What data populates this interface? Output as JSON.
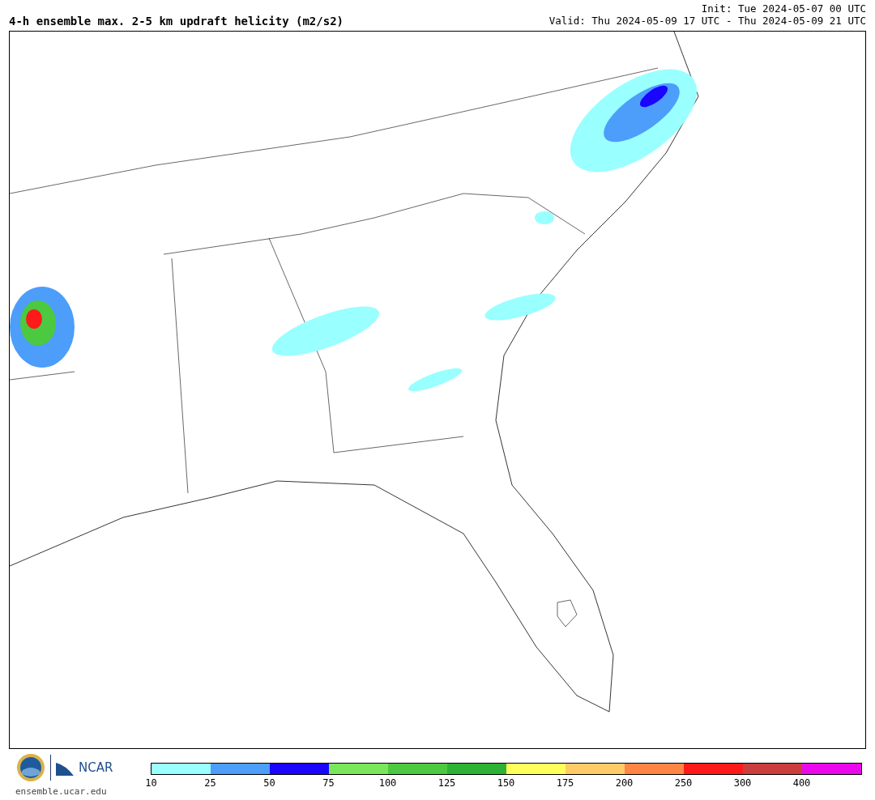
{
  "title": "4-h ensemble max. 2-5 km updraft helicity (m2/s2)",
  "init": "Init: Tue 2024-05-07 00 UTC",
  "valid": "Valid: Thu 2024-05-09 17 UTC - Thu 2024-05-09 21 UTC",
  "logo_text": "NCAR",
  "website": "ensemble.ucar.edu",
  "colorbar": [
    {
      "label": "10",
      "color": "#99ffff"
    },
    {
      "label": "25",
      "color": "#4d9dfa"
    },
    {
      "label": "50",
      "color": "#1a05ff"
    },
    {
      "label": "75",
      "color": "#7ae65c"
    },
    {
      "label": "100",
      "color": "#4cc940"
    },
    {
      "label": "125",
      "color": "#2db235"
    },
    {
      "label": "150",
      "color": "#ffff5c"
    },
    {
      "label": "175",
      "color": "#ffcb66"
    },
    {
      "label": "200",
      "color": "#ff8545"
    },
    {
      "label": "250",
      "color": "#ff1a1a"
    },
    {
      "label": "300",
      "color": "#cc3d3d"
    },
    {
      "label": "400",
      "color": "#ec08ec"
    }
  ]
}
